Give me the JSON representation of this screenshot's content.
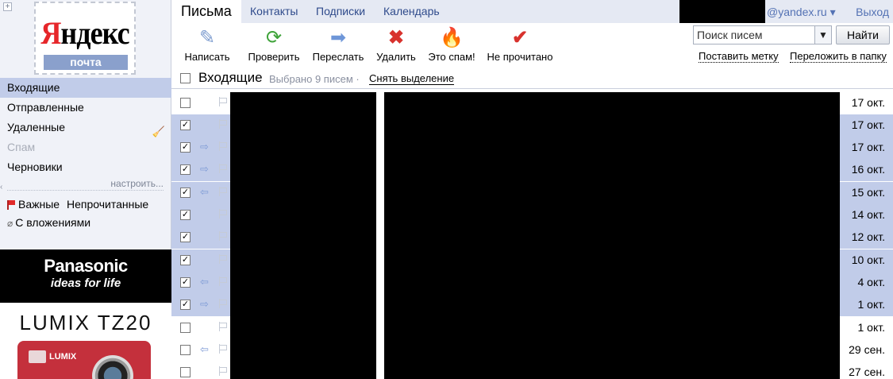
{
  "app": {
    "logo_text_first": "Я",
    "logo_text_rest": "ндекс",
    "logo_sub": "почта",
    "plus_symbol": "+"
  },
  "nav": {
    "tabs": [
      {
        "label": "Письма"
      },
      {
        "label": "Контакты"
      },
      {
        "label": "Подписки"
      },
      {
        "label": "Календарь"
      }
    ],
    "user_domain": "@yandex.ru ▾",
    "logout": "Выход"
  },
  "toolbar": {
    "compose": "Написать",
    "check": "Проверить",
    "forward": "Переслать",
    "delete": "Удалить",
    "spam": "Это спам!",
    "unread": "Не прочитано"
  },
  "search": {
    "placeholder": "Поиск писем",
    "button": "Найти",
    "dropdown": "▼"
  },
  "actions": {
    "set_label": "Поставить метку",
    "move_to_folder": "Переложить в папку"
  },
  "folders": [
    {
      "label": "Входящие",
      "active": true
    },
    {
      "label": "Отправленные"
    },
    {
      "label": "Удаленные"
    },
    {
      "label": "Спам",
      "disabled": true
    },
    {
      "label": "Черновики"
    }
  ],
  "configure": "настроить...",
  "filters": {
    "important": "Важные",
    "unread": "Непрочитанные",
    "attachments": "С вложениями"
  },
  "ad": {
    "brand": "Panasonic",
    "slogan": "ideas for life",
    "model": "LUMIX TZ20",
    "camera_label": "LUMIX"
  },
  "list": {
    "title": "Входящие",
    "selected_info": "Выбрано 9 писем ·",
    "unselect": "Снять выделение"
  },
  "messages": [
    {
      "date": "17 окт.",
      "selected": false,
      "reply": ""
    },
    {
      "date": "17 окт.",
      "selected": true,
      "reply": ""
    },
    {
      "date": "17 окт.",
      "selected": true,
      "reply": "⇨"
    },
    {
      "date": "16 окт.",
      "selected": true,
      "reply": "⇨"
    },
    {
      "date": "15 окт.",
      "selected": true,
      "reply": "⇦"
    },
    {
      "date": "14 окт.",
      "selected": true,
      "reply": ""
    },
    {
      "date": "12 окт.",
      "selected": true,
      "reply": ""
    },
    {
      "date": "10 окт.",
      "selected": true,
      "reply": ""
    },
    {
      "date": "4 окт.",
      "selected": true,
      "reply": "⇦"
    },
    {
      "date": "1 окт.",
      "selected": true,
      "reply": "⇨"
    },
    {
      "date": "1 окт.",
      "selected": false,
      "reply": ""
    },
    {
      "date": "29 сен.",
      "selected": false,
      "reply": "⇦"
    },
    {
      "date": "27 сен.",
      "selected": false,
      "reply": ""
    }
  ],
  "check_mark": "✓"
}
